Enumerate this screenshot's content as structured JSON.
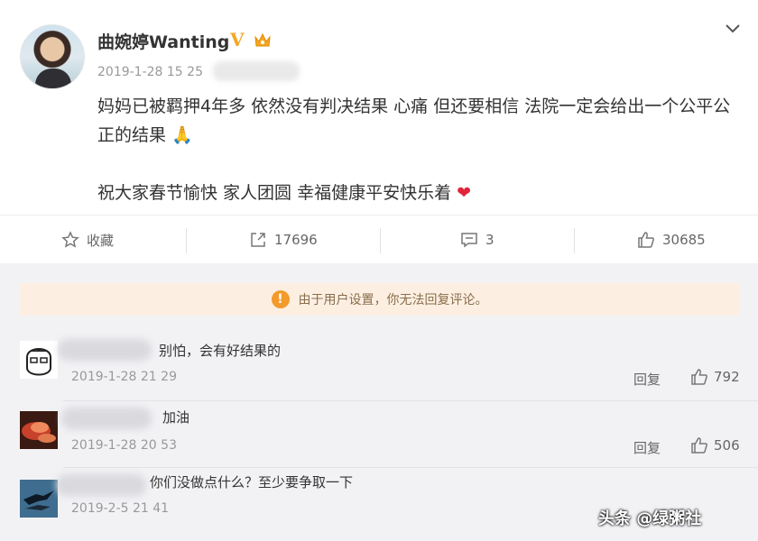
{
  "post": {
    "username": "曲婉婷Wanting",
    "verified_mark": "V",
    "timestamp": "2019-1-28 15 25",
    "line1": "妈妈已被羁押4年多 依然没有判决结果 心痛 但还要相信 法院一定会给出一个公平公正的结果",
    "line2": "祝大家春节愉快 家人团圆 幸福健康平安快乐着",
    "emoji_pray": "🙏",
    "emoji_heart": "❤"
  },
  "actions": {
    "favorite_label": "收藏",
    "repost_count": "17696",
    "comment_count": "3",
    "like_count": "30685"
  },
  "notice": {
    "text": "由于用户设置，你无法回复评论。"
  },
  "comments": [
    {
      "text": "别怕，会有好结果的",
      "time": "2019-1-28 21 29",
      "reply": "回复",
      "likes": "792"
    },
    {
      "text": "加油",
      "time": "2019-1-28 20 53",
      "reply": "回复",
      "likes": "506"
    },
    {
      "text": "你们没做点什么？至少要争取一下",
      "time": "2019-2-5 21 41",
      "reply": "",
      "likes": ""
    }
  ],
  "watermark": "头条 @绿粥社",
  "icons": {
    "more": "chevron-down-icon",
    "favorite": "star-icon",
    "repost": "share-icon",
    "comment": "comment-icon",
    "like": "thumb-up-icon",
    "notice": "alert-icon"
  },
  "colors": {
    "verified": "#f5a623",
    "notice_bg": "#fcefe2",
    "notice_icon": "#f39a2b",
    "heart": "#e0243a"
  }
}
